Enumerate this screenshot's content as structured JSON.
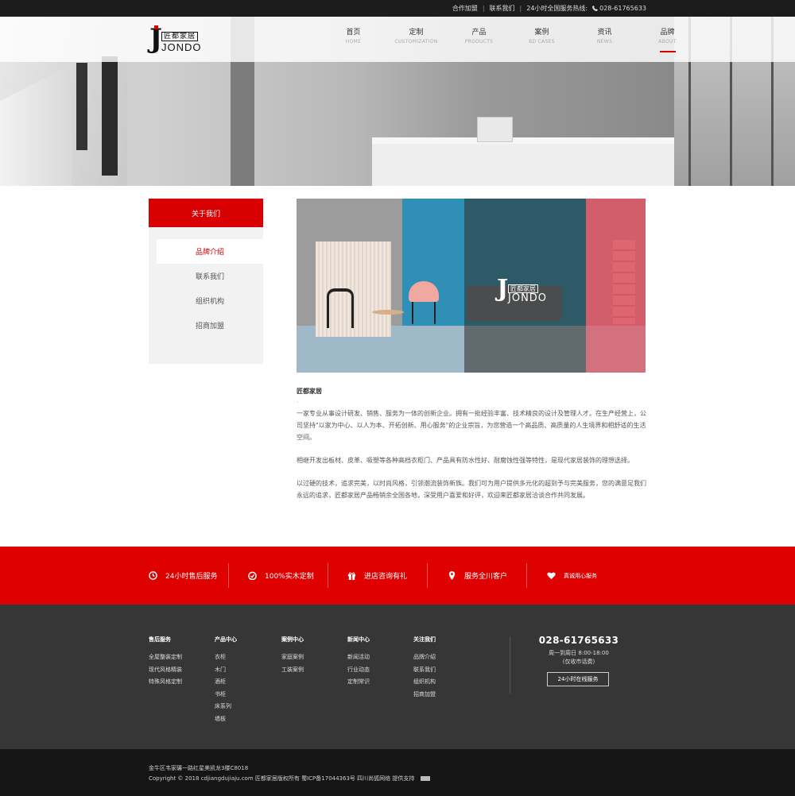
{
  "topbar": {
    "links": [
      "合作加盟",
      "联系我们"
    ],
    "hotline_label": "24小时全国服务热线:",
    "hotline_number": "028-61765633"
  },
  "brand": {
    "logo_cn": "匠都家居",
    "logo_en": "JONDO",
    "accent_color": "#d80000"
  },
  "nav": {
    "items": [
      {
        "cn": "首页",
        "en": "HOME"
      },
      {
        "cn": "定制",
        "en": "CUSTOMIZATION"
      },
      {
        "cn": "产品",
        "en": "PRODUCTS"
      },
      {
        "cn": "案例",
        "en": "BD CASES"
      },
      {
        "cn": "资讯",
        "en": "NEWS"
      },
      {
        "cn": "品牌",
        "en": "ABOUT"
      }
    ],
    "active": "品牌"
  },
  "sidebar": {
    "title": "关于我们",
    "items": [
      "品牌介绍",
      "联系我们",
      "组织机构",
      "招商加盟"
    ],
    "active": "品牌介绍"
  },
  "article": {
    "heading": "匠都家居",
    "dot": "·",
    "paragraphs": [
      "一家专业从事设计研发、销售、服务为一体的创新企业。拥有一批经验丰富、技术精良的设计及管理人才。在生产经营上，公司坚持\"以家为中心、以人为本、开拓创新、用心服务\"的企业宗旨，为您营造一个高品质、高质量的人生境界和相舒适的生活空间。",
      "相继开发出板材、皮革、吸塑等各种高档衣柜门、产品具有防水性好、耐腐蚀性强等特性，是现代家居装饰的理想选择。",
      "以过硬的技术，追求完美，以时尚风格，引领潮流装饰新族。我们可为用户提供多元化的超到予与完美服务，您的满意足我们永远的追求，匠都家居产品畅销余全国各地，深受用户喜爱和好评，欢迎来匠都家居洽谈合作共同发展。"
    ]
  },
  "services": [
    {
      "icon": "clock-icon",
      "label": "24小时售后服务"
    },
    {
      "icon": "medal-icon",
      "label": "100%实木定制"
    },
    {
      "icon": "gift-icon",
      "label": "进店咨询有礼"
    },
    {
      "icon": "location-pin-icon",
      "label": "服务全川客户"
    },
    {
      "icon": "heart-icon",
      "label": "真诚用心服务"
    }
  ],
  "footer": {
    "columns": [
      {
        "title": "售后服务",
        "links": [
          "全屋整装定制",
          "现代风格精装",
          "特殊风格定制"
        ]
      },
      {
        "title": "产品中心",
        "links": [
          "衣柜",
          "木门",
          "酒柜",
          "书柜",
          "床系列",
          "墙板"
        ]
      },
      {
        "title": "案例中心",
        "links": [
          "家庭案例",
          "工装案例"
        ]
      },
      {
        "title": "新闻中心",
        "links": [
          "新闻活动",
          "行业动态",
          "定制常识"
        ]
      },
      {
        "title": "关注我们",
        "links": [
          "品牌介绍",
          "联系我们",
          "组织机构",
          "招商加盟"
        ]
      }
    ],
    "phone": "028-61765633",
    "hours": "周一到周日 8:00-18:00",
    "hours_note": "(仅收市话费)",
    "online_button": "24小时在线服务"
  },
  "bottom": {
    "address": "金牛区韦家碾一路红星美凯龙3楼C8018",
    "copyright": "Copyright © 2018 cdjiangdujiaju.com 匠都家居版权所有 蜀ICP备17044363号   四川尚狐网络 提供支持"
  }
}
